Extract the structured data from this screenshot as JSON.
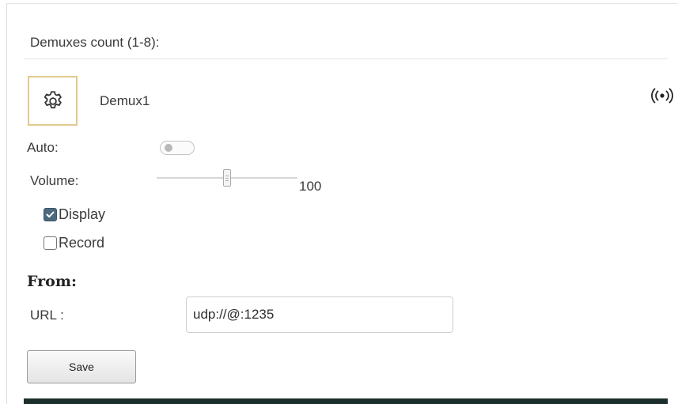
{
  "demuxes": {
    "count_label": "Demuxes count (1-8):"
  },
  "demux": {
    "name": "Demux1",
    "settings_icon": "gear-icon",
    "status_icon": "broadcast-icon"
  },
  "controls": {
    "auto_label": "Auto:",
    "auto_enabled": false,
    "volume_label": "Volume:",
    "volume_value": "100",
    "volume_level_fraction": 0.5,
    "display_label": "Display",
    "display_checked": true,
    "record_label": "Record",
    "record_checked": false
  },
  "source": {
    "heading": "From:",
    "url_label": "URL :",
    "url_value": "udp://@:1235"
  },
  "actions": {
    "save_label": "Save"
  },
  "colors": {
    "settings_border": "#e3c98e",
    "checkbox_checked": "#4c6a7e",
    "bottom_bar": "#1c2e2b"
  }
}
